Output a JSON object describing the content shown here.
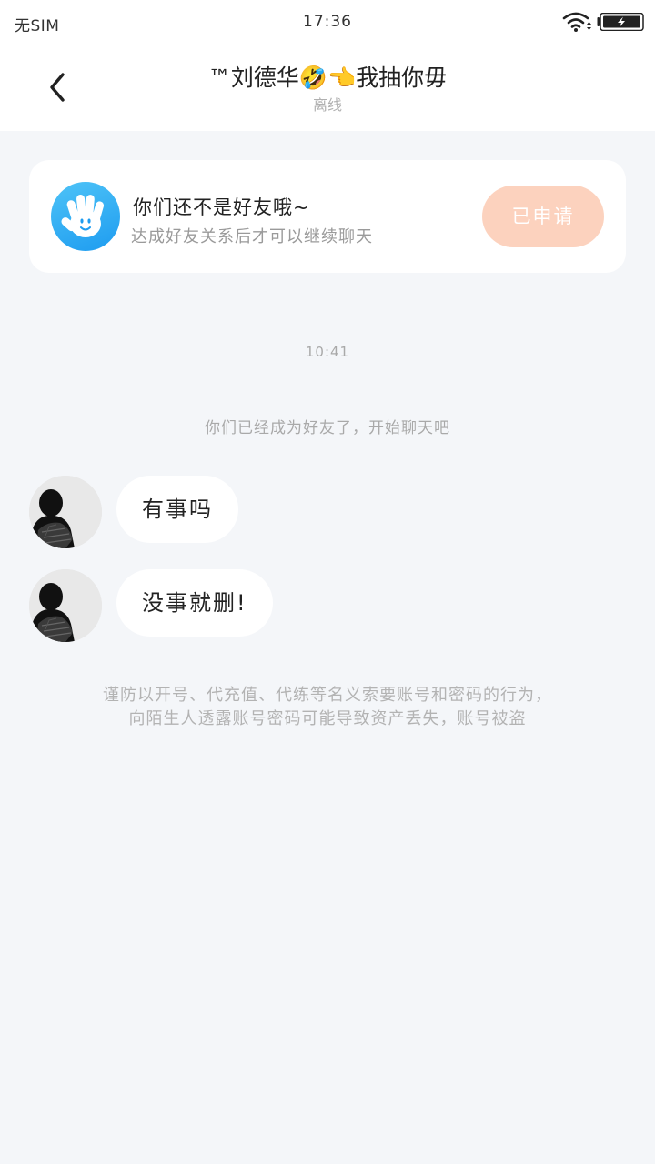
{
  "status_bar": {
    "carrier": "无SIM",
    "time": "17:36",
    "wifi_icon": "wifi-icon",
    "battery_icon": "battery-charging-icon"
  },
  "nav": {
    "back_icon": "chevron-left-icon",
    "title": "™刘德华🤣👈我抽你毋",
    "subtitle": "离线"
  },
  "friend_card": {
    "icon": "waving-hand-icon",
    "title": "你们还不是好友哦~",
    "description": "达成好友关系后才可以继续聊天",
    "apply_label": "已申请",
    "apply_color": "#fcd2be",
    "icon_color": "#2aa8f3"
  },
  "chat": {
    "timestamp": "10:41",
    "system_message": "你们已经成为好友了，开始聊天吧",
    "messages": [
      {
        "text": "有事吗",
        "avatar": "user-avatar"
      },
      {
        "text": "没事就删!",
        "avatar": "user-avatar"
      }
    ],
    "warning_line1": "谨防以开号、代充值、代练等名义索要账号和密码的行为，",
    "warning_line2": "向陌生人透露账号密码可能导致资产丢失，账号被盗"
  },
  "colors": {
    "background": "#f4f6f9",
    "card": "#ffffff",
    "muted_text": "#a9a9a9"
  }
}
